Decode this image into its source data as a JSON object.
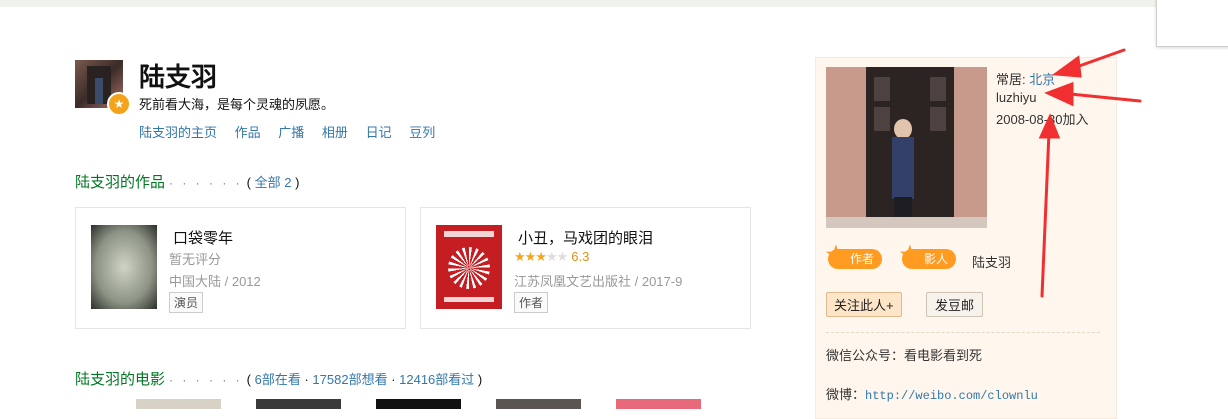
{
  "profile": {
    "name": "陆支羽",
    "motto": "死前看大海，是每个灵魂的夙愿。",
    "nav": [
      "陆支羽的主页",
      "作品",
      "广播",
      "相册",
      "日记",
      "豆列"
    ]
  },
  "works_section": {
    "title": "陆支羽的作品",
    "count_link": "全部 2"
  },
  "works": [
    {
      "title": "口袋零年",
      "rating_text": "暂无评分",
      "meta": "中国大陆 / 2012",
      "role": "演员"
    },
    {
      "title": "小丑，马戏团的眼泪",
      "stars": 3,
      "score": "6.3",
      "meta": "江苏凤凰文艺出版社 / 2017-9",
      "role": "作者"
    }
  ],
  "movies_section": {
    "title": "陆支羽的电影",
    "watching": "6部在看",
    "wish": "17582部想看",
    "watched": "12416部看过"
  },
  "sidebar": {
    "residence_label": "常居:",
    "residence_city": "北京",
    "user_id": "luzhiyu",
    "joined": "2008-08-30加入",
    "tag_author": "作者",
    "tag_film": "影人",
    "tag_name": "陆支羽",
    "follow_button": "关注此人+",
    "mail_button": "发豆邮",
    "wechat": "微信公众号：看电影看到死",
    "weibo_label": "微博：",
    "weibo_url": "http://weibo.com/clownlu"
  },
  "colors": {
    "link": "#3377aa",
    "section_green": "#007722",
    "tag_orange": "#ff9b20",
    "annotation_red": "#f03030"
  }
}
